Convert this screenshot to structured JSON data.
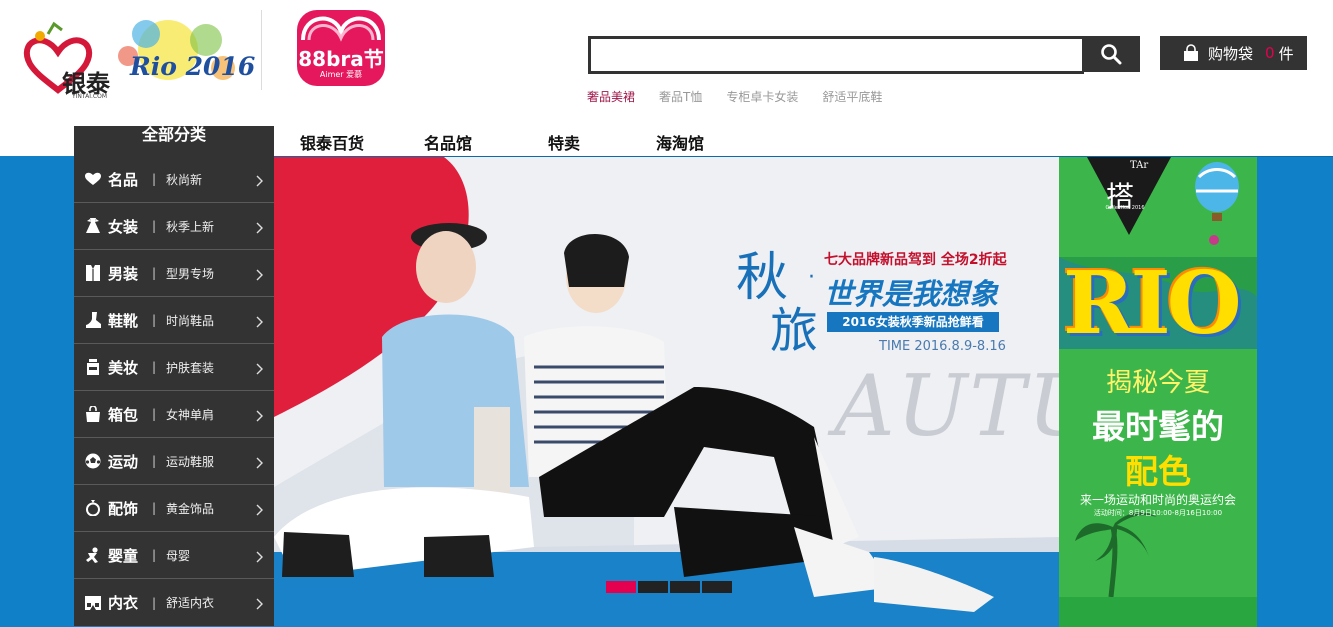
{
  "logos": {
    "yintai_text": "银泰",
    "yintai_domain": "YINTAI.COM",
    "rio_text": "Rio 2016",
    "bra_text": "88bra节",
    "bra_brand": "Aimer 爱慕"
  },
  "search": {
    "value": "",
    "placeholder": "",
    "hot_keywords": [
      "奢品美裙",
      "奢品T恤",
      "专柜卓卡女装",
      "舒适平底鞋"
    ]
  },
  "cart": {
    "label": "购物袋",
    "count": "0",
    "unit": "件"
  },
  "nav": {
    "items": [
      "银泰百货",
      "名品馆",
      "特卖",
      "海淘馆"
    ]
  },
  "categories": {
    "title": "全部分类",
    "items": [
      {
        "name": "名品",
        "sub": "秋尚新",
        "icon": "heart-icon"
      },
      {
        "name": "女装",
        "sub": "秋季上新",
        "icon": "dress-icon"
      },
      {
        "name": "男装",
        "sub": "型男专场",
        "icon": "shirt-icon"
      },
      {
        "name": "鞋靴",
        "sub": "时尚鞋品",
        "icon": "boot-icon"
      },
      {
        "name": "美妆",
        "sub": "护肤套装",
        "icon": "cosmetic-bottle-icon"
      },
      {
        "name": "箱包",
        "sub": "女神单肩",
        "icon": "bag-icon"
      },
      {
        "name": "运动",
        "sub": "运动鞋服",
        "icon": "soccer-ball-icon"
      },
      {
        "name": "配饰",
        "sub": "黄金饰品",
        "icon": "ring-icon"
      },
      {
        "name": "婴童",
        "sub": "母婴",
        "icon": "baby-icon"
      },
      {
        "name": "内衣",
        "sub": "舒适内衣",
        "icon": "underwear-icon"
      }
    ]
  },
  "banner": {
    "qiu": "秋",
    "lv": "旅",
    "dot": "·",
    "headline": "七大品牌新品驾到 全场2折起",
    "slogan": "世界是我想象",
    "pill": "2016女装秋季新品抢鲜看",
    "time": "TIME 2016.8.9-8.16",
    "watermark": "AUTU",
    "slides": 4,
    "active_slide": 1
  },
  "side_ad": {
    "da": "搭",
    "tar": "TAr",
    "collection": "Collection 2016",
    "rio": "RIO",
    "line1": "揭秘今夏",
    "line2": "最时髦的",
    "line3": "配色",
    "line4": "来一场运动和时尚的奥运约会",
    "line5": "活动时间：8月9日10:00-8月16日10:00"
  },
  "colors": {
    "dark": "#333333",
    "accent": "#e4004f",
    "banner_blue": "#1081c9",
    "ad_green": "#39b54a"
  }
}
